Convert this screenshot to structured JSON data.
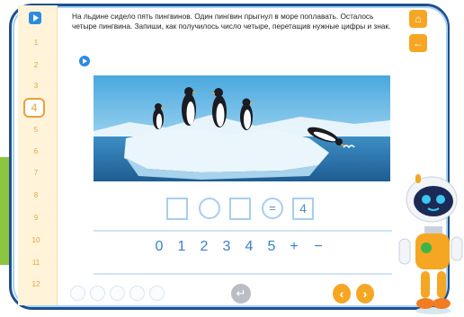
{
  "rail": {
    "play_icon": "play-icon",
    "pages": [
      "1",
      "2",
      "3",
      "4",
      "5",
      "6",
      "7",
      "8",
      "9",
      "10",
      "11",
      "12"
    ],
    "active_page": "4"
  },
  "controls": {
    "home_icon": "home-icon",
    "back_icon": "arrow-left-icon"
  },
  "task": {
    "text": "На льдине сидело пять пингвинов. Один пингвин прыгнул в море поплавать. Осталось четыре пингвина. Запиши, как получилось число четыре, перетащив нужные цифры и знак.",
    "sound_icon": "play-icon"
  },
  "answer": {
    "equals_sign": "=",
    "result_value": "4"
  },
  "tiles": [
    "0",
    "1",
    "2",
    "3",
    "4",
    "5",
    "+",
    "−"
  ],
  "bottom": {
    "progress_dots": 5,
    "enter_icon": "enter-icon",
    "prev_icon": "chevron-left-icon",
    "next_icon": "chevron-right-icon"
  },
  "colors": {
    "frame": "#1e4f8f",
    "accent_orange": "#f5a623",
    "accent_blue": "#2d8be0",
    "slot_border": "#a8cdef",
    "tile_text": "#3a7fc9"
  }
}
